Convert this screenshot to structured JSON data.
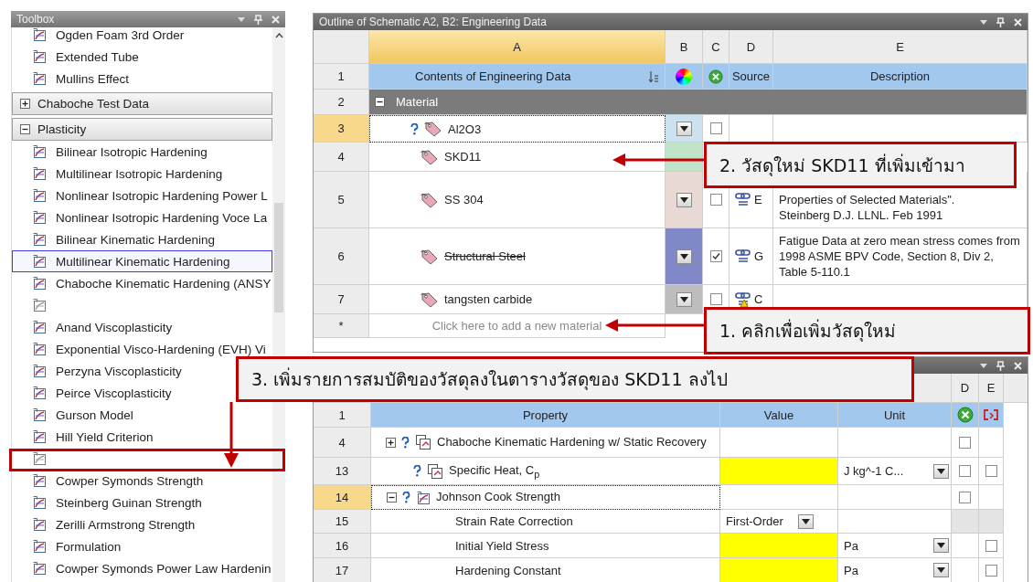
{
  "toolbox": {
    "title": "Toolbox",
    "items": [
      {
        "kind": "item",
        "label": "Ogden Foam 3rd Order",
        "selected": false
      },
      {
        "kind": "item",
        "label": "Extended Tube",
        "selected": false
      },
      {
        "kind": "item",
        "label": "Mullins Effect",
        "selected": false
      },
      {
        "kind": "group",
        "label": "Chaboche Test Data",
        "expanded": false
      },
      {
        "kind": "group",
        "label": "Plasticity",
        "expanded": true
      },
      {
        "kind": "item",
        "label": "Bilinear Isotropic Hardening",
        "selected": false
      },
      {
        "kind": "item",
        "label": "Multilinear Isotropic Hardening",
        "selected": false
      },
      {
        "kind": "item",
        "label": "Nonlinear Isotropic Hardening Power L",
        "selected": false
      },
      {
        "kind": "item",
        "label": "Nonlinear Isotropic Hardening Voce La",
        "selected": false
      },
      {
        "kind": "item",
        "label": "Bilinear Kinematic Hardening",
        "selected": false
      },
      {
        "kind": "item",
        "label": "Multilinear Kinematic Hardening",
        "selected": true
      },
      {
        "kind": "item",
        "label": "Chaboche Kinematic Hardening (ANSY",
        "selected": false
      },
      {
        "kind": "item",
        "selected": false
      },
      {
        "kind": "item",
        "label": "Anand Viscoplasticity",
        "selected": false
      },
      {
        "kind": "item",
        "label": "Exponential Visco-Hardening (EVH) Vi",
        "selected": false
      },
      {
        "kind": "item",
        "label": "Perzyna Viscoplasticity",
        "selected": false
      },
      {
        "kind": "item",
        "label": "Peirce Viscoplasticity",
        "selected": false
      },
      {
        "kind": "item",
        "label": "Gurson Model",
        "selected": false
      },
      {
        "kind": "item",
        "label": "Hill Yield Criterion",
        "selected": false
      },
      {
        "kind": "item",
        "selected": false
      },
      {
        "kind": "item",
        "label": "Cowper Symonds Strength",
        "selected": false
      },
      {
        "kind": "item",
        "label": "Steinberg Guinan Strength",
        "selected": false
      },
      {
        "kind": "item",
        "label": "Zerilli Armstrong Strength",
        "selected": false
      },
      {
        "kind": "item",
        "label": "Formulation",
        "selected": false
      },
      {
        "kind": "item",
        "label": "Cowper Symonds Power Law Hardenin",
        "selected": false
      }
    ]
  },
  "outline": {
    "title": "Outline of Schematic A2, B2: Engineering Data",
    "columns": [
      {
        "letter": "A",
        "selected": true
      },
      {
        "letter": "B",
        "selected": false
      },
      {
        "letter": "C",
        "selected": false
      },
      {
        "letter": "D",
        "selected": false
      },
      {
        "letter": "E",
        "selected": false
      }
    ],
    "rows": [
      {
        "number": "1",
        "kind": "header",
        "label": "Contents of Engineering Data",
        "source": "Source",
        "description": "Description"
      },
      {
        "number": "2",
        "kind": "group",
        "label": "Material",
        "expanded": true
      },
      {
        "number": "3",
        "kind": "material",
        "label": "Al2O3",
        "selected": true,
        "help": true,
        "struck": false,
        "color": "#cde2f0",
        "checked": false
      },
      {
        "number": "4",
        "kind": "material",
        "label": "SKD11",
        "selected": false,
        "struck": false,
        "color": "#bfe4c8"
      },
      {
        "number": "5",
        "kind": "material",
        "label": "SS 304",
        "selected": false,
        "struck": false,
        "color": "#e9d9d5",
        "checked": false,
        "source": "E",
        "description": "Properties of Selected Materials\".\nSteinberg D.J. LLNL. Feb 1991"
      },
      {
        "number": "6",
        "kind": "material",
        "label": "Structural Steel",
        "selected": false,
        "struck": true,
        "color": "#8088c8",
        "checked": true,
        "source": "G",
        "description": "Fatigue Data at zero mean stress comes from 1998 ASME BPV Code, Section 8, Div 2, Table 5-110.1"
      },
      {
        "number": "7",
        "kind": "material",
        "label": "tangsten carbide",
        "selected": false,
        "struck": false,
        "color": "#bdbdbd",
        "checked": false,
        "source": "C",
        "warning": true
      }
    ],
    "new_row": {
      "marker": "*",
      "placeholder": "Click here to add a new material"
    }
  },
  "properties": {
    "columns": [
      {
        "letter": "D"
      },
      {
        "letter": "E"
      }
    ],
    "header": {
      "number": "1",
      "property": "Property",
      "value": "Value",
      "unit": "Unit"
    },
    "rows": [
      {
        "number": "4",
        "kind": "group",
        "label": "Chaboche Kinematic Hardening w/ Static Recovery",
        "expanded": false,
        "help": true,
        "selected": false,
        "d_checked": false
      },
      {
        "number": "13",
        "kind": "property",
        "label": "Specific Heat, C$_{p}$",
        "help": true,
        "value_missing": true,
        "unit": "J kg^-1 C...",
        "d_checked": false,
        "e_checked": false
      },
      {
        "number": "14",
        "kind": "group",
        "label": "Johnson Cook Strength",
        "expanded": true,
        "help": true,
        "selected": true,
        "d_checked": false
      },
      {
        "number": "15",
        "kind": "option",
        "label": "Strain Rate Correction",
        "value": "First-Order"
      },
      {
        "number": "16",
        "kind": "property",
        "label": "Initial Yield Stress",
        "value_missing": true,
        "unit": "Pa",
        "e_checked": false
      },
      {
        "number": "17",
        "kind": "property",
        "label": "Hardening Constant",
        "value_missing": true,
        "unit": "Pa",
        "e_checked": false
      }
    ]
  },
  "callouts": [
    "2. วัสดุใหม่ SKD11 ที่เพิ่มเข้ามา",
    "1. คลิกเพื่อเพิ่มวัสดุใหม่",
    "3. เพิ่มรายการสมบัติของวัสดุลงในตารางวัสดุของ SKD11 ลงไป"
  ]
}
